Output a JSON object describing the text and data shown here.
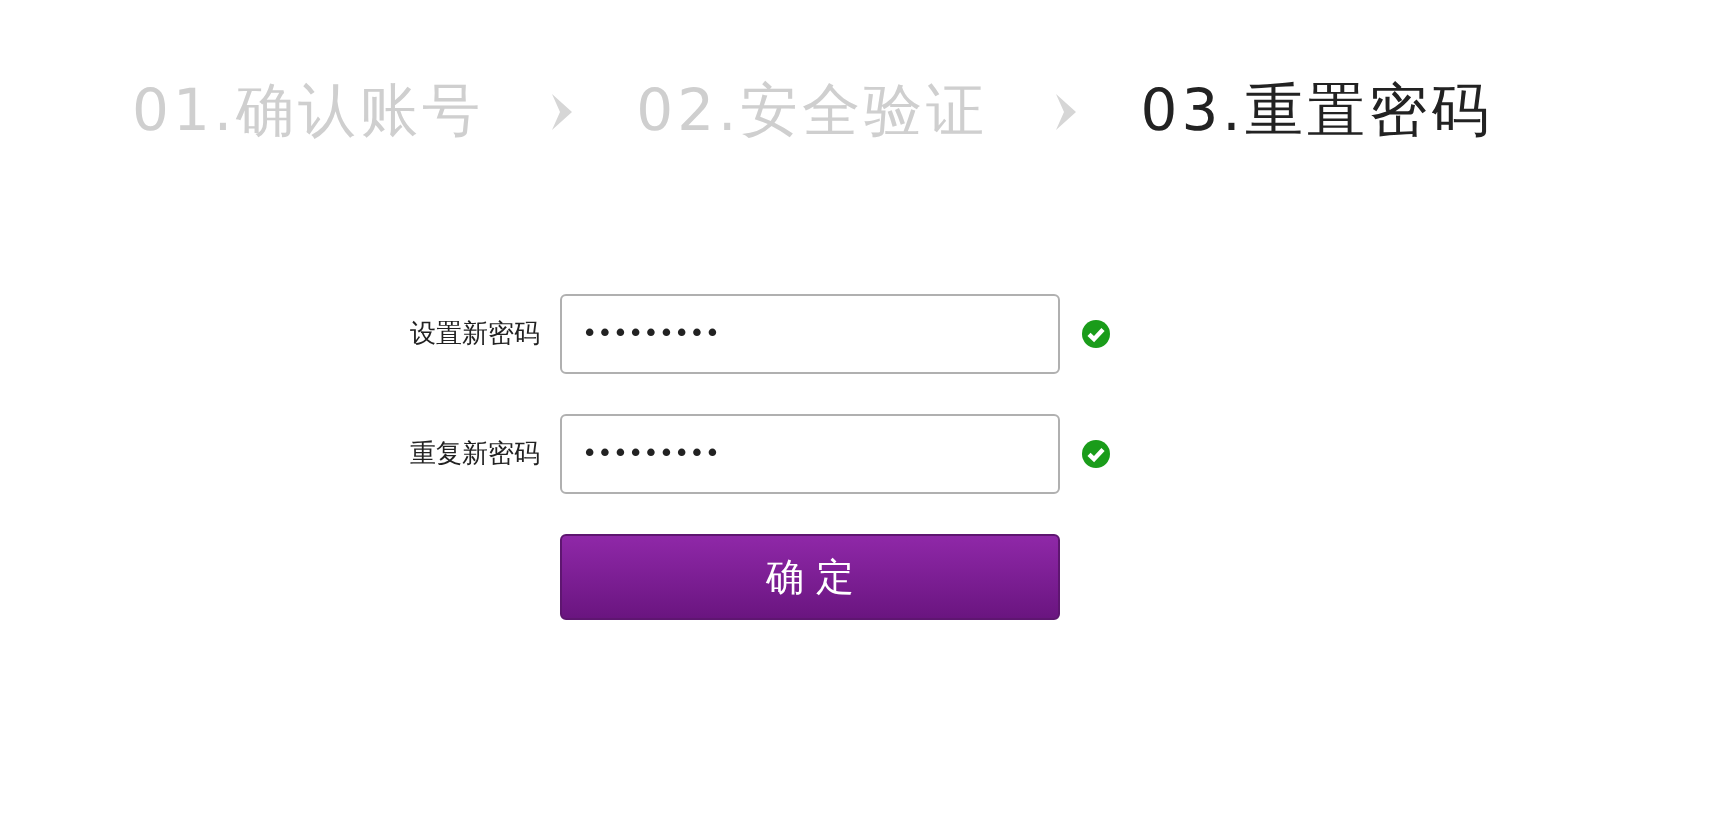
{
  "steps": [
    {
      "label": "01.确认账号",
      "selected": false
    },
    {
      "label": "02.安全验证",
      "selected": false
    },
    {
      "label": "03.重置密码",
      "selected": true
    }
  ],
  "fields": [
    {
      "label": "设置新密码",
      "value": "•••••••••",
      "valid": true
    },
    {
      "label": "重复新密码",
      "value": "•••••••••",
      "valid": true
    }
  ],
  "submit_button": "确 定"
}
